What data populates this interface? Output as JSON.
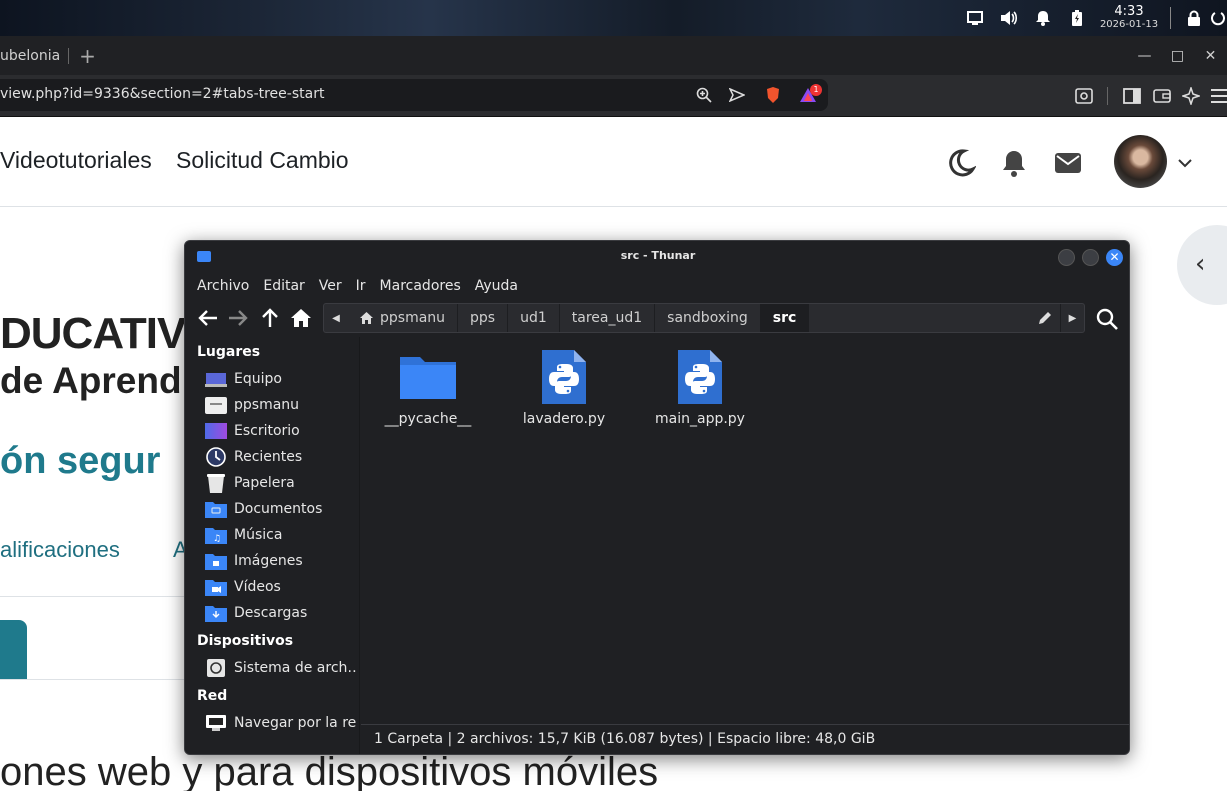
{
  "panel": {
    "time": "4:33",
    "date": "2026-01-13"
  },
  "browser": {
    "tab_title": "ubelonia",
    "new_tab": "+",
    "url": "view.php?id=9336&section=2#tabs-tree-start",
    "brave_badge_count": "1"
  },
  "page": {
    "nav_links": [
      "Videotutoriales",
      "Solicitud Cambio"
    ],
    "heading_fragment_1": "DUCATIVO",
    "heading_fragment_2": "de Aprendi",
    "course_title_fragment": "ón segur",
    "course_tabs": [
      "alificaciones",
      "A"
    ],
    "bottom_heading_fragment": "ones web y para dispositivos móviles"
  },
  "thunar": {
    "title": "src - Thunar",
    "menu": [
      "Archivo",
      "Editar",
      "Ver",
      "Ir",
      "Marcadores",
      "Ayuda"
    ],
    "breadcrumbs": [
      "ppsmanu",
      "pps",
      "ud1",
      "tarea_ud1",
      "sandboxing",
      "src"
    ],
    "sidebar": {
      "places_heading": "Lugares",
      "places": [
        {
          "label": "Equipo",
          "icon": "computer-icon"
        },
        {
          "label": "ppsmanu",
          "icon": "home-folder-icon"
        },
        {
          "label": "Escritorio",
          "icon": "desktop-icon"
        },
        {
          "label": "Recientes",
          "icon": "recent-icon"
        },
        {
          "label": "Papelera",
          "icon": "trash-icon"
        },
        {
          "label": "Documentos",
          "icon": "documents-folder-icon"
        },
        {
          "label": "Música",
          "icon": "music-folder-icon"
        },
        {
          "label": "Imágenes",
          "icon": "pictures-folder-icon"
        },
        {
          "label": "Vídeos",
          "icon": "videos-folder-icon"
        },
        {
          "label": "Descargas",
          "icon": "downloads-folder-icon"
        }
      ],
      "devices_heading": "Dispositivos",
      "devices": [
        {
          "label": "Sistema de arch…",
          "icon": "drive-icon"
        }
      ],
      "network_heading": "Red",
      "network": [
        {
          "label": "Navegar por la red",
          "icon": "network-icon"
        }
      ]
    },
    "files": [
      {
        "name": "__pycache__",
        "type": "folder"
      },
      {
        "name": "lavadero.py",
        "type": "python"
      },
      {
        "name": "main_app.py",
        "type": "python"
      }
    ],
    "status": "1 Carpeta  |  2 archivos: 15,7 KiB (16.087 bytes)  |  Espacio libre: 48,0 GiB"
  },
  "colors": {
    "accent": "#3b86f7",
    "course_teal": "#1f7a8c",
    "thunar_bg": "#1f2023"
  }
}
